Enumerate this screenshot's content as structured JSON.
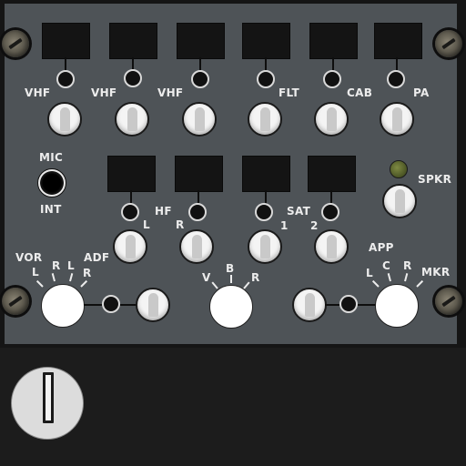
{
  "transmit_row": {
    "items": [
      {
        "label": "VHF"
      },
      {
        "label": "VHF"
      },
      {
        "label": "VHF"
      },
      {
        "label": "FLT"
      },
      {
        "label": "CAB"
      },
      {
        "label": "PA"
      }
    ]
  },
  "mic_int": {
    "top_label": "MIC",
    "bottom_label": "INT"
  },
  "second_row": {
    "hf_label": "HF",
    "hf_left": "L",
    "hf_right": "R",
    "sat_label": "SAT",
    "sat_1": "1",
    "sat_2": "2",
    "spkr_label": "SPKR"
  },
  "vor_adf": {
    "vor_label": "VOR",
    "vor_l": "L",
    "vor_r": "R",
    "adf_l": "L",
    "adf_r": "R",
    "adf_label": "ADF"
  },
  "vbr": {
    "v": "V",
    "b": "B",
    "r": "R"
  },
  "app_mkr": {
    "app_label": "APP",
    "l": "L",
    "c": "C",
    "r": "R",
    "mkr_label": "MKR"
  },
  "colors": {
    "panel": "#4e5357",
    "bezel": "#151515",
    "text": "#ececec",
    "led_green": "#6b7634"
  }
}
